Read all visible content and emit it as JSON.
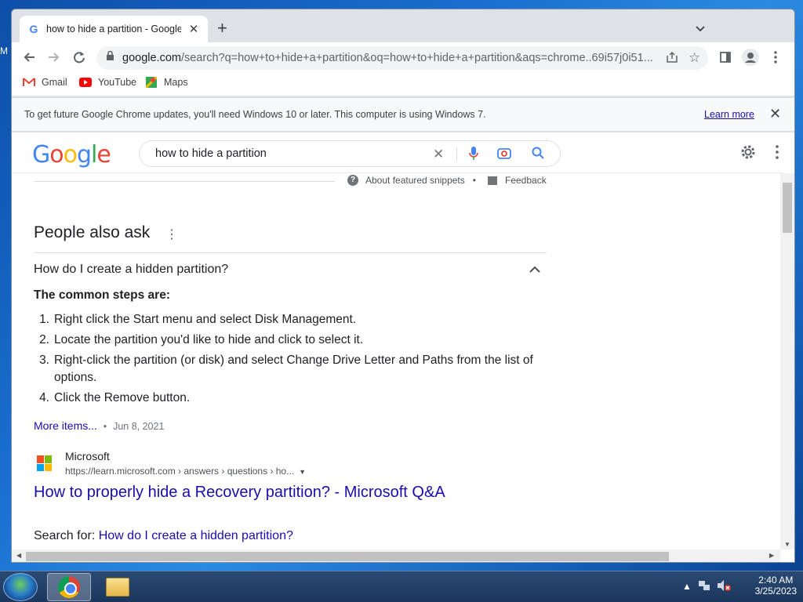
{
  "browser": {
    "tab": {
      "title": "how to hide a partition - Google",
      "close": "✕"
    },
    "new_tab": "+",
    "url_domain": "google.com",
    "url_path": "/search?q=how+to+hide+a+partition&oq=how+to+hide+a+partition&aqs=chrome..69i57j0i51..."
  },
  "bookmarks": [
    {
      "label": "Gmail",
      "icon": "gmail-icon"
    },
    {
      "label": "YouTube",
      "icon": "youtube-icon"
    },
    {
      "label": "Maps",
      "icon": "maps-icon"
    }
  ],
  "infobar": {
    "message": "To get future Google Chrome updates, you'll need Windows 10 or later. This computer is using Windows 7.",
    "learn_more": "Learn more"
  },
  "google": {
    "logo": "Google",
    "query": "how to hide a partition",
    "about_snippets": "About featured snippets",
    "feedback": "Feedback",
    "paa_title": "People also ask",
    "question": "How do I create a hidden partition?",
    "steps_head": "The common steps are:",
    "steps": [
      {
        "n": "1.",
        "text": "Right click the Start menu and select Disk Management."
      },
      {
        "n": "2.",
        "text": "Locate the partition you'd like to hide and click to select it."
      },
      {
        "n": "3.",
        "text": "Right-click the partition (or disk) and select Change Drive Letter and Paths from the list of options."
      },
      {
        "n": "4.",
        "text": "Click the Remove button."
      }
    ],
    "more_items": "More items...",
    "date": "Jun 8, 2021",
    "source_name": "Microsoft",
    "source_url": "https://learn.microsoft.com › answers › questions › ho...",
    "result_title": "How to properly hide a Recovery partition? - Microsoft Q&A",
    "search_for_label": "Search for:",
    "search_for_link": "How do I create a hidden partition?"
  },
  "taskbar": {
    "time": "2:40 AM",
    "date": "3/25/2023"
  }
}
